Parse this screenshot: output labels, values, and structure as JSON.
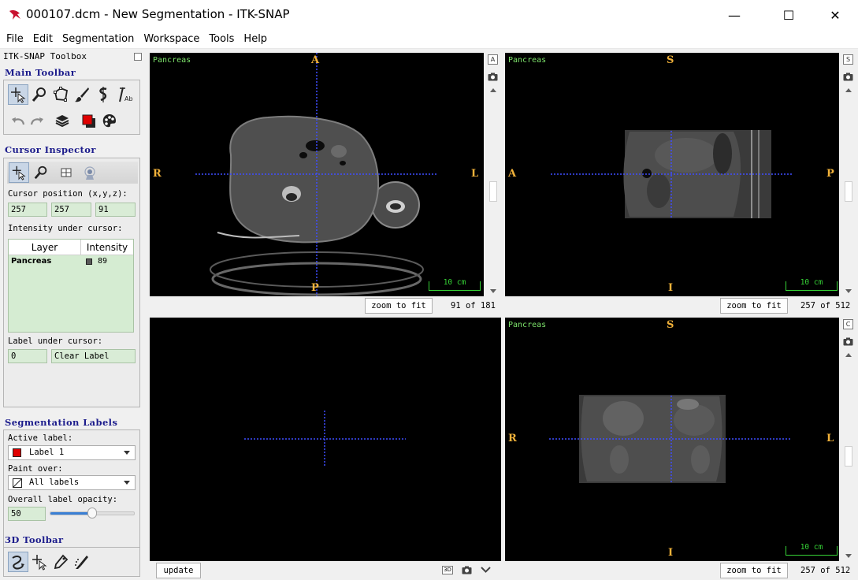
{
  "window": {
    "title": "000107.dcm - New Segmentation - ITK-SNAP",
    "minimize_glyph": "—",
    "maximize_glyph": "☐",
    "close_glyph": "✕"
  },
  "menu": [
    "File",
    "Edit",
    "Segmentation",
    "Workspace",
    "Tools",
    "Help"
  ],
  "toolbox": {
    "title": "ITK-SNAP Toolbox",
    "main_toolbar_title": "Main Toolbar",
    "main_tools_row1": [
      "crosshair-icon",
      "zoom-icon",
      "polygon-icon",
      "paintbrush-icon",
      "snake-icon",
      "annotation-icon"
    ],
    "main_tools_row2": [
      "undo-icon",
      "redo-icon",
      "layers-icon",
      "label-color-icon",
      "palette-icon"
    ],
    "cursor_inspector_title": "Cursor Inspector",
    "cursor_position_label": "Cursor position (x,y,z):",
    "cursor_x": "257",
    "cursor_y": "257",
    "cursor_z": "91",
    "intensity_label": "Intensity under cursor:",
    "intensity_table": {
      "headers": [
        "Layer",
        "Intensity"
      ],
      "rows": [
        {
          "layer": "Pancreas",
          "intensity": "89",
          "swatch": "#595959"
        }
      ]
    },
    "label_under_cursor_label": "Label under cursor:",
    "label_id": "0",
    "label_name": "Clear Label",
    "segmentation_labels_title": "Segmentation Labels",
    "active_label_label": "Active label:",
    "active_label_value": "Label 1",
    "active_label_color": "#e00000",
    "paint_over_label": "Paint over:",
    "paint_over_value": "All labels",
    "opacity_label": "Overall label opacity:",
    "opacity_value": "50",
    "opacity_fraction": 0.5,
    "toolbar_3d_title": "3D Toolbar"
  },
  "views": {
    "axial": {
      "layer": "Pancreas",
      "top": "A",
      "bottom": "P",
      "left": "R",
      "right": "L",
      "scale": "10 cm",
      "corner": "A",
      "zoom": "zoom to fit",
      "slices": "91 of 181"
    },
    "sagittal": {
      "layer": "Pancreas",
      "top": "S",
      "bottom": "I",
      "left": "A",
      "right": "P",
      "scale": "10 cm",
      "corner": "S",
      "zoom": "zoom to fit",
      "slices": "257 of 512"
    },
    "coronal": {
      "layer": "Pancreas",
      "top": "S",
      "bottom": "I",
      "left": "R",
      "right": "L",
      "scale": "10 cm",
      "corner": "C",
      "zoom": "zoom to fit",
      "slices": "257 of 512"
    },
    "three_d": {
      "update": "update",
      "mode_badge": "3D"
    }
  },
  "colors": {
    "crosshair": "#3f4dff",
    "orientation": "#f2b23a",
    "layer_text": "#7de36b",
    "section_title": "#1c1c8c"
  }
}
